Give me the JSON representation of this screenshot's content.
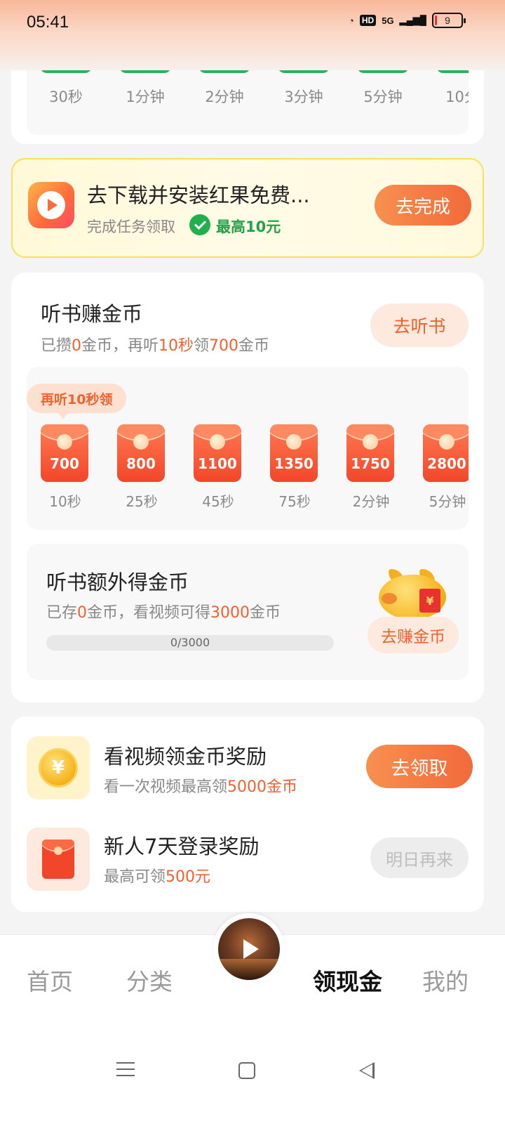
{
  "status_bar": {
    "time": "05:41",
    "network": "5G",
    "hd": "HD",
    "battery": "9",
    "battery_level_percent": 9
  },
  "timer_strip": {
    "items": [
      "30秒",
      "1分钟",
      "2分钟",
      "3分钟",
      "5分钟",
      "10分"
    ],
    "accent_color": "#27b45a"
  },
  "ad_banner": {
    "title": "去下载并安装红果免费...",
    "subtitle": "完成任务领取",
    "reward": "最高10元",
    "button": "去完成"
  },
  "listen_section": {
    "title": "听书赚金币",
    "sub_prefix": "已攒",
    "sub_coins": "0",
    "sub_mid1": "金币，再听",
    "sub_time": "10秒",
    "sub_mid2": "领",
    "sub_reward": "700",
    "sub_suffix": "金币",
    "button": "去听书",
    "tip": "再听10秒领",
    "packets": [
      {
        "amount": "700",
        "label": "10秒"
      },
      {
        "amount": "800",
        "label": "25秒"
      },
      {
        "amount": "1100",
        "label": "45秒"
      },
      {
        "amount": "1350",
        "label": "75秒"
      },
      {
        "amount": "1750",
        "label": "2分钟"
      },
      {
        "amount": "2800",
        "label": "5分钟"
      }
    ]
  },
  "extra_section": {
    "title": "听书额外得金币",
    "sub_prefix": "已存",
    "sub_coins": "0",
    "sub_mid": "金币，看视频可得",
    "sub_reward": "3000",
    "sub_suffix": "金币",
    "progress_text": "0/3000",
    "progress_fraction": 0,
    "pig_tag": "¥",
    "button": "去赚金币"
  },
  "reward_section": {
    "video": {
      "coin_symbol": "¥",
      "title": "看视频领金币奖励",
      "sub_prefix": "看一次视频最高领",
      "sub_highlight": "5000金币",
      "button": "去领取"
    },
    "login": {
      "title": "新人7天登录奖励",
      "sub_prefix": "最高可领",
      "sub_highlight": "500元",
      "button": "明日再来"
    }
  },
  "bottom_nav": {
    "items": [
      "首页",
      "分类",
      "领现金",
      "我的"
    ],
    "active": "领现金"
  },
  "colors": {
    "accent": "#f0612e",
    "button_gradient_start": "#f7904f",
    "button_gradient_end": "#f26a3a",
    "success_green": "#22a34a"
  }
}
